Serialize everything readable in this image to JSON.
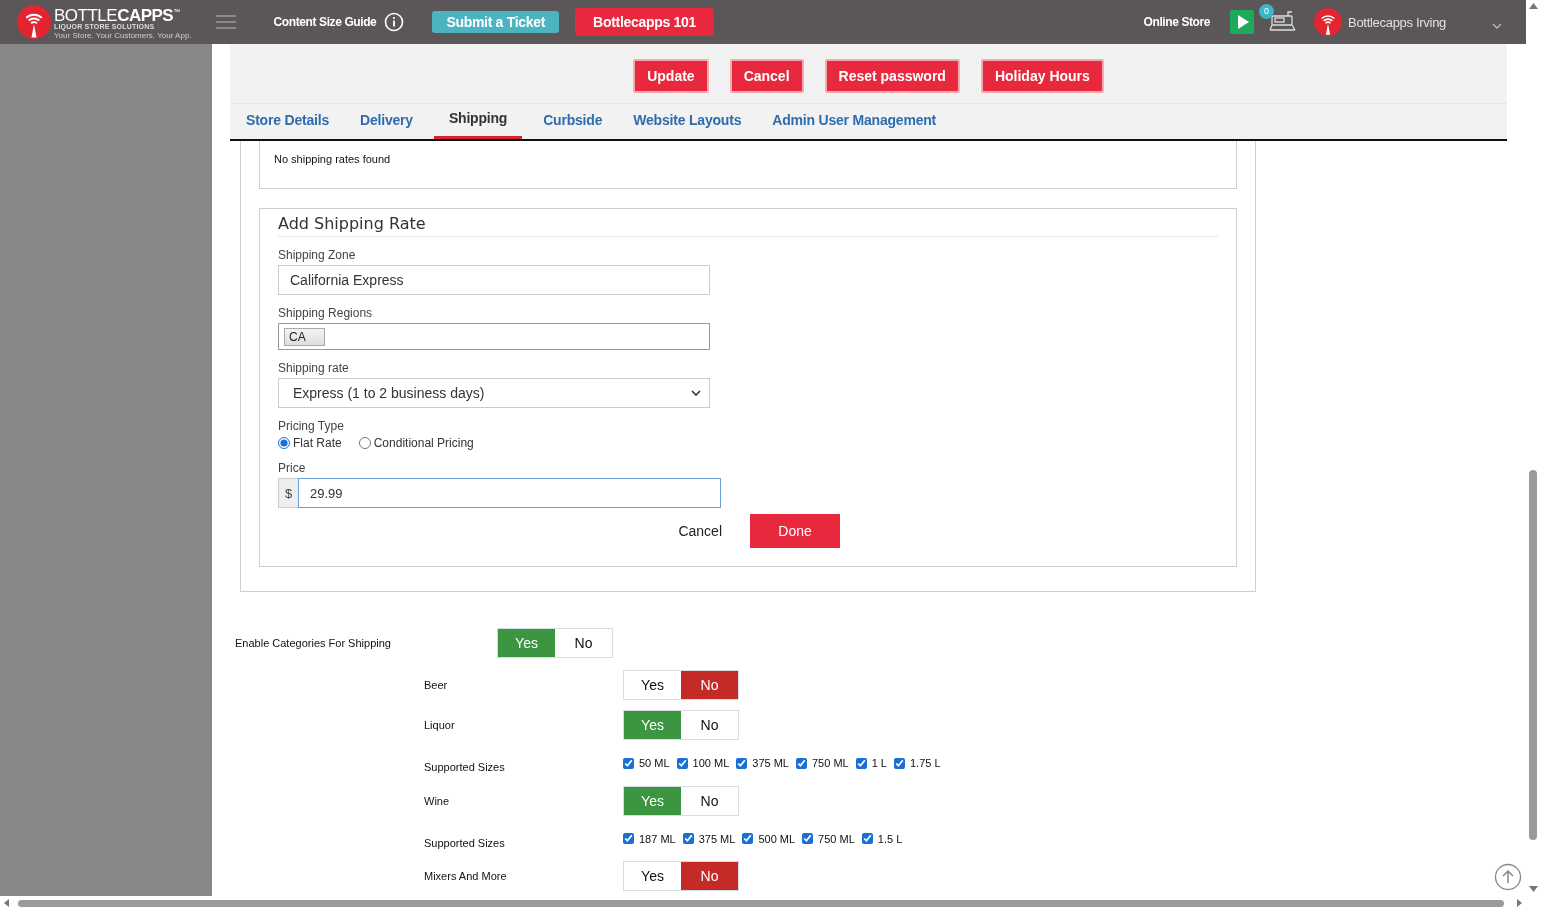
{
  "header": {
    "logo": {
      "wordmark": "BOTTLE**CAPPS**$^{™}$",
      "tagline": "LIQUOR STORE SOLUTIONS",
      "slogan": "Your Store. Your Customers. Your App."
    },
    "guide_link": "Content Size Guide",
    "buttons": [
      {
        "label": "Submit a Ticket",
        "kind": "teal"
      },
      {
        "label": "Bottlecapps 101",
        "kind": "red"
      }
    ],
    "store_link": "Online Store",
    "notification_count": "0",
    "user_name": "Bottlecapps Irving"
  },
  "actions": [
    "Update",
    "Cancel",
    "Reset password",
    "Holiday Hours"
  ],
  "tabs": [
    {
      "label": "Store Details",
      "selected": false
    },
    {
      "label": "Delivery",
      "selected": false
    },
    {
      "label": "Shipping",
      "selected": true
    },
    {
      "label": "Curbside",
      "selected": false
    },
    {
      "label": "Website Layouts",
      "selected": false
    },
    {
      "label": "Admin User Management",
      "selected": false
    }
  ],
  "rates": {
    "empty_message": "No shipping rates found"
  },
  "add_rate": {
    "title": "Add Shipping Rate",
    "zone": {
      "label": "Shipping Zone",
      "value": "California Express"
    },
    "regions": {
      "label": "Shipping Regions",
      "tags": [
        "CA"
      ]
    },
    "rate": {
      "label": "Shipping rate",
      "value": "Express (1 to 2 business days)"
    },
    "pricing_type": {
      "label": "Pricing Type",
      "options": [
        {
          "label": "Flat Rate",
          "selected": true
        },
        {
          "label": "Conditional Pricing",
          "selected": false
        }
      ]
    },
    "price": {
      "label": "Price",
      "prefix": "$",
      "value": "29.99"
    },
    "cancel": "Cancel",
    "done": "Done"
  },
  "categories": {
    "enable": {
      "label": "Enable Categories For Shipping",
      "yes": "Yes",
      "no": "No",
      "on": true
    },
    "items": [
      {
        "kind": "toggle",
        "label": "Beer",
        "yes": "Yes",
        "no": "No",
        "on": false
      },
      {
        "kind": "toggle",
        "label": "Liquor",
        "yes": "Yes",
        "no": "No",
        "on": true
      },
      {
        "kind": "sizes",
        "label": "Supported Sizes",
        "sizes": [
          {
            "label": "50 ML",
            "checked": true
          },
          {
            "label": "100 ML",
            "checked": true
          },
          {
            "label": "375 ML",
            "checked": true
          },
          {
            "label": "750 ML",
            "checked": true
          },
          {
            "label": "1 L",
            "checked": true
          },
          {
            "label": "1.75 L",
            "checked": true
          }
        ]
      },
      {
        "kind": "toggle",
        "label": "Wine",
        "yes": "Yes",
        "no": "No",
        "on": true
      },
      {
        "kind": "sizes",
        "label": "Supported Sizes",
        "sizes": [
          {
            "label": "187 ML",
            "checked": true
          },
          {
            "label": "375 ML",
            "checked": true
          },
          {
            "label": "500 ML",
            "checked": true
          },
          {
            "label": "750 ML",
            "checked": true
          },
          {
            "label": "1.5 L",
            "checked": true
          }
        ]
      },
      {
        "kind": "toggle",
        "label": "Mixers And More",
        "yes": "Yes",
        "no": "No",
        "on": false
      }
    ]
  }
}
